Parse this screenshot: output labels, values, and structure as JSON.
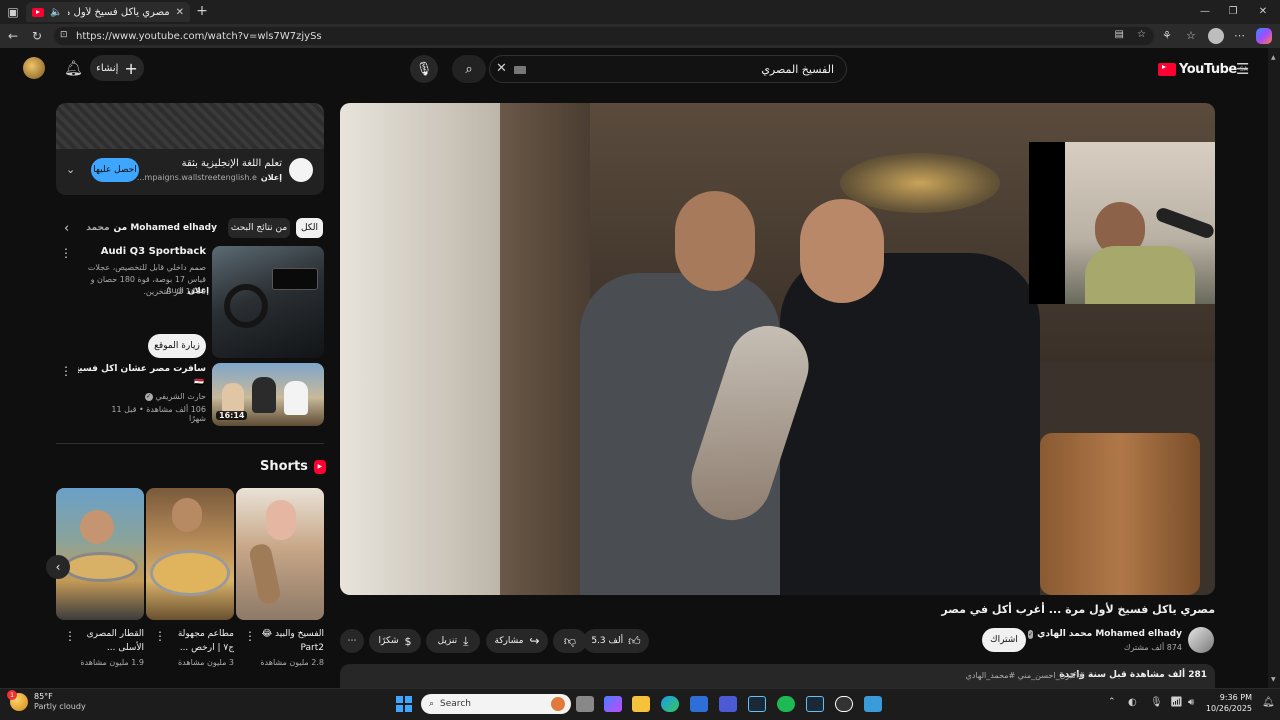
{
  "browser": {
    "tab_title": "مصري ياكل فسيخ لأول مرة ...",
    "new_tab": "+",
    "url": "https://www.youtube.com/watch?v=wls7W7zjySs",
    "win_min": "—",
    "win_max": "❐",
    "win_close": "✕"
  },
  "youtube": {
    "logo": "YouTube",
    "region": "SA",
    "search_value": "الفسيخ المصري",
    "create_label": "إنشاء"
  },
  "ad": {
    "title": "تعلم اللغة الإنجليزية بثقة",
    "badge": "إعلان",
    "url": "...mpaigns.wallstreetenglish.e",
    "cta": "احصل عليها"
  },
  "chips": [
    "الكل",
    "من نتائج البحث",
    "من Mohamed elhady",
    "محمد الهادي"
  ],
  "related": {
    "ad_video": {
      "title": "Audi Q3 Sportback",
      "desc": "صمم داخلي قابل للتخصيص، عجلات قياس 17 بوصة، قوة 180 حصان و 1400 لتر للتخزين.",
      "badge": "إعلان",
      "sponsor": "Audi",
      "cta": "زيارة الموقع"
    },
    "video": {
      "title": "سافرت مصر عشان أكل فسيخ لأول مرة !!",
      "flag": "🇪🇬",
      "channel": "حارث الشريفي",
      "meta": "106 ألف مشاهدة • قبل 11 شهرًا",
      "duration": "16:14"
    }
  },
  "shorts": {
    "title": "Shorts",
    "items": [
      {
        "title": "القطار المصرى الأسلى ...",
        "views": "1.9 مليون مشاهدة"
      },
      {
        "title": "مطاعم مجهولة ج٧ | ارخص ...",
        "views": "3 مليون مشاهدة"
      },
      {
        "title": "الفسيخ والبيد 😂 Part2",
        "views": "2.8 مليون مشاهدة"
      }
    ]
  },
  "video": {
    "title": "مصري ياكل فسيخ لأول مرة ... أغرب أكل في مصر",
    "channel": "محمد الهادي Mohamed elhady",
    "subscribers": "874 ألف مشترك",
    "subscribe": "اشتراك",
    "likes": "5.3 ألف",
    "share": "مشاركة",
    "download": "تنزيل",
    "thanks": "شكرًا",
    "desc_meta": "281 ألف مشاهدة قبل سنة واحدة",
    "desc_tags": "#اكبرن_احسن_مني #محمد_الهادي"
  },
  "taskbar": {
    "temp": "85°F",
    "weather": "Partly cloudy",
    "weather_badge": "1",
    "search": "Search",
    "time": "9:36 PM",
    "date": "10/26/2025"
  },
  "colors": {
    "accent_blue": "#3ea6ff",
    "subscribe_bg": "#f1f1f1",
    "youtube_red": "#ff0033"
  }
}
